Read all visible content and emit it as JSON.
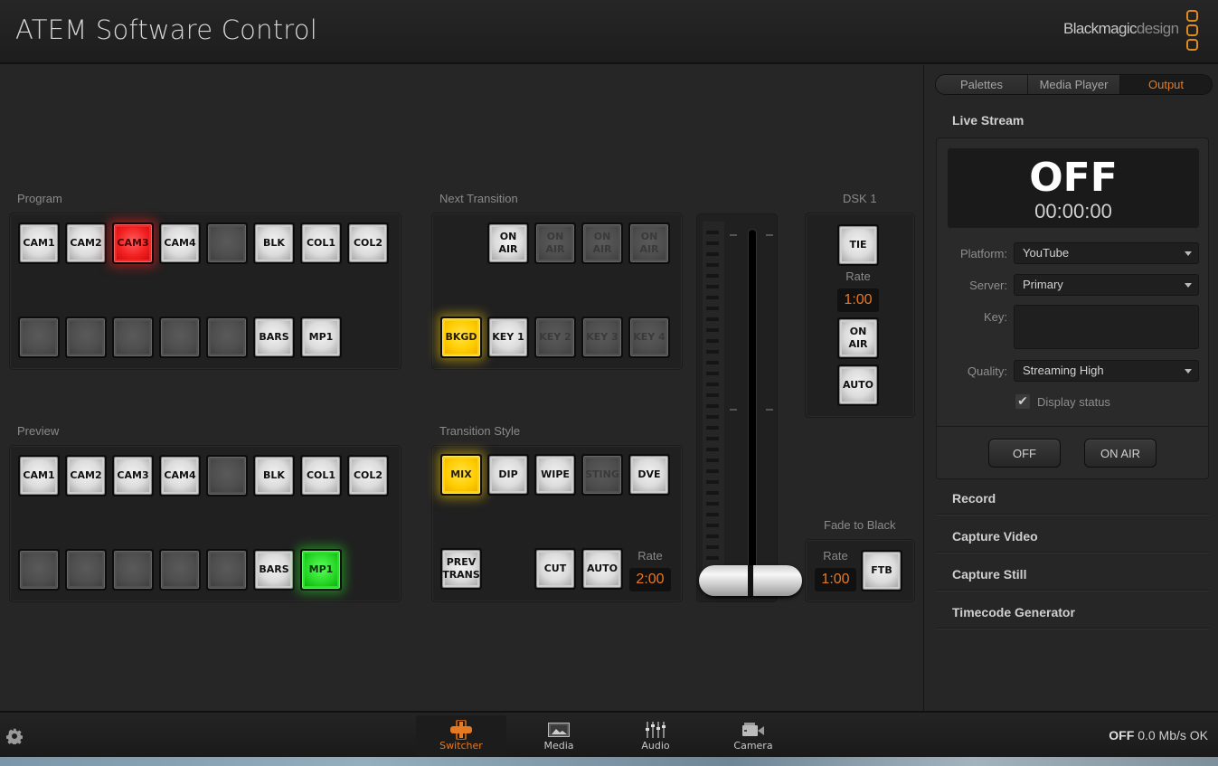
{
  "header": {
    "title": "ATEM Software Control",
    "logo_part1": "Blackmagic",
    "logo_part2": "design"
  },
  "program": {
    "label": "Program",
    "row1": [
      {
        "label": "CAM1",
        "state": "normal"
      },
      {
        "label": "CAM2",
        "state": "normal"
      },
      {
        "label": "CAM3",
        "state": "red"
      },
      {
        "label": "CAM4",
        "state": "normal"
      },
      {
        "label": "",
        "state": "off"
      },
      {
        "label": "BLK",
        "state": "normal"
      },
      {
        "label": "COL1",
        "state": "normal"
      },
      {
        "label": "COL2",
        "state": "normal"
      }
    ],
    "row2": [
      {
        "label": "",
        "state": "off"
      },
      {
        "label": "",
        "state": "off"
      },
      {
        "label": "",
        "state": "off"
      },
      {
        "label": "",
        "state": "off"
      },
      {
        "label": "",
        "state": "off"
      },
      {
        "label": "BARS",
        "state": "normal"
      },
      {
        "label": "MP1",
        "state": "normal"
      }
    ]
  },
  "preview": {
    "label": "Preview",
    "row1": [
      {
        "label": "CAM1",
        "state": "normal"
      },
      {
        "label": "CAM2",
        "state": "normal"
      },
      {
        "label": "CAM3",
        "state": "normal"
      },
      {
        "label": "CAM4",
        "state": "normal"
      },
      {
        "label": "",
        "state": "off"
      },
      {
        "label": "BLK",
        "state": "normal"
      },
      {
        "label": "COL1",
        "state": "normal"
      },
      {
        "label": "COL2",
        "state": "normal"
      }
    ],
    "row2": [
      {
        "label": "",
        "state": "off"
      },
      {
        "label": "",
        "state": "off"
      },
      {
        "label": "",
        "state": "off"
      },
      {
        "label": "",
        "state": "off"
      },
      {
        "label": "",
        "state": "off"
      },
      {
        "label": "BARS",
        "state": "normal"
      },
      {
        "label": "MP1",
        "state": "green"
      }
    ]
  },
  "next_transition": {
    "label": "Next Transition",
    "on_air": [
      {
        "label": "ON AIR",
        "state": "normal"
      },
      {
        "label": "ON AIR",
        "state": "off"
      },
      {
        "label": "ON AIR",
        "state": "off"
      },
      {
        "label": "ON AIR",
        "state": "off"
      }
    ],
    "layers": [
      {
        "label": "BKGD",
        "state": "yellow"
      },
      {
        "label": "KEY 1",
        "state": "normal"
      },
      {
        "label": "KEY 2",
        "state": "off"
      },
      {
        "label": "KEY 3",
        "state": "off"
      },
      {
        "label": "KEY 4",
        "state": "off"
      }
    ]
  },
  "transition_style": {
    "label": "Transition Style",
    "styles": [
      {
        "label": "MIX",
        "state": "yellow"
      },
      {
        "label": "DIP",
        "state": "normal"
      },
      {
        "label": "WIPE",
        "state": "normal"
      },
      {
        "label": "STING",
        "state": "off"
      },
      {
        "label": "DVE",
        "state": "normal"
      }
    ],
    "prev_trans": "PREV TRANS",
    "cut": "CUT",
    "auto": "AUTO",
    "rate_label": "Rate",
    "rate": "2:00"
  },
  "tbar": {
    "position": 1.0
  },
  "dsk": {
    "label": "DSK 1",
    "tie": "TIE",
    "rate_label": "Rate",
    "rate": "1:00",
    "on_air": "ON AIR",
    "auto": "AUTO"
  },
  "ftb": {
    "label": "Fade to Black",
    "rate_label": "Rate",
    "rate": "1:00",
    "button": "FTB"
  },
  "sidebar": {
    "tabs": [
      {
        "label": "Palettes",
        "active": false
      },
      {
        "label": "Media Player",
        "active": false
      },
      {
        "label": "Output",
        "active": true
      }
    ],
    "live_stream": {
      "title": "Live Stream",
      "state": "OFF",
      "time": "00:00:00",
      "platform_label": "Platform:",
      "platform": "YouTube",
      "server_label": "Server:",
      "server": "Primary",
      "key_label": "Key:",
      "key": "",
      "quality_label": "Quality:",
      "quality": "Streaming High",
      "display_status_label": "Display status",
      "display_status_checked": true,
      "off_button": "OFF",
      "on_air_button": "ON AIR"
    },
    "sections": [
      "Record",
      "Capture Video",
      "Capture Still",
      "Timecode Generator"
    ]
  },
  "bottom_nav": {
    "items": [
      {
        "label": "Switcher",
        "icon": "switcher-icon",
        "active": true
      },
      {
        "label": "Media",
        "icon": "media-icon",
        "active": false
      },
      {
        "label": "Audio",
        "icon": "audio-icon",
        "active": false
      },
      {
        "label": "Camera",
        "icon": "camera-icon",
        "active": false
      }
    ],
    "status_state": "OFF",
    "status_rate": "0.0 Mb/s OK"
  },
  "colors": {
    "accent": "#e67a22",
    "program": "#f22020",
    "preview": "#28d828",
    "selected": "#ffcc00"
  }
}
